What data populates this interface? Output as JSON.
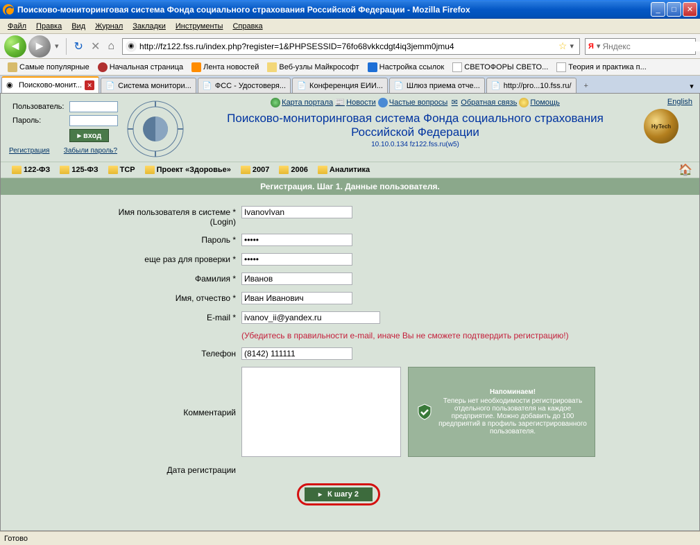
{
  "window": {
    "title": "Поисково-мониторинговая система Фонда социального страхования Российской Федерации - Mozilla Firefox"
  },
  "menu": {
    "file": "Файл",
    "edit": "Правка",
    "view": "Вид",
    "history": "Журнал",
    "bookmarks": "Закладки",
    "tools": "Инструменты",
    "help": "Справка"
  },
  "urlbar": {
    "url": "http://fz122.fss.ru/index.php?register=1&PHPSESSID=76fo68vkkcdgt4iq3jemm0jmu4"
  },
  "search": {
    "placeholder": "Яндекс",
    "icon": "Я"
  },
  "bookmarks": [
    {
      "label": "Самые популярные",
      "icon": "pop"
    },
    {
      "label": "Начальная страница",
      "icon": "red"
    },
    {
      "label": "Лента новостей",
      "icon": "rss"
    },
    {
      "label": "Веб-узлы Майкрософт",
      "icon": "folder"
    },
    {
      "label": "Настройка ссылок",
      "icon": "blue"
    },
    {
      "label": "СВЕТОФОРЫ СВЕТО...",
      "icon": "white"
    },
    {
      "label": "Теория и практика п...",
      "icon": "white"
    }
  ],
  "tabs": [
    {
      "label": "Поисково-монит...",
      "active": true
    },
    {
      "label": "Система монитори..."
    },
    {
      "label": "ФСС - Удостоверя..."
    },
    {
      "label": "Конференция ЕИИ..."
    },
    {
      "label": "Шлюз приема отче..."
    },
    {
      "label": "http://pro...10.fss.ru/"
    }
  ],
  "login": {
    "user_label": "Пользователь:",
    "pass_label": "Пароль:",
    "button": "вход",
    "register": "Регистрация",
    "forgot": "Забыли пароль?"
  },
  "topnav": {
    "map": "Карта портала",
    "news": "Новости",
    "faq": "Частые вопросы",
    "feedback": "Обратная связь",
    "help": "Помощь",
    "english": "English"
  },
  "header": {
    "title1": "Поисково-мониторинговая система Фонда социального страхования",
    "title2": "Российской Федерации",
    "sub": "10.10.0.134  fz122.fss.ru(w5)"
  },
  "folders": [
    "122-ФЗ",
    "125-ФЗ",
    "TCP",
    "Проект «Здоровье»",
    "2007",
    "2006",
    "Аналитика"
  ],
  "step": {
    "title": "Регистрация. Шаг 1. Данные пользователя."
  },
  "form": {
    "login_label": "Имя пользователя в системе *\n(Login)",
    "login_label1": "Имя пользователя в системе *",
    "login_label2": "(Login)",
    "login_val": "IvanovIvan",
    "pass_label": "Пароль *",
    "pass_val": "●●●●●",
    "pass2_label": "еще раз для проверки *",
    "pass2_val": "●●●●●",
    "lastname_label": "Фамилия *",
    "lastname_val": "Иванов",
    "firstname_label": "Имя, отчество *",
    "firstname_val": "Иван Иванович",
    "email_label": "E-mail *",
    "email_val": "ivanov_ii@yandex.ru",
    "email_warn": "(Убедитесь в правильности e-mail, иначе Вы не сможете подтвердить регистрацию!)",
    "phone_label": "Телефон",
    "phone_val": "(8142) 111111",
    "comment_label": "Комментарий",
    "remind_title": "Напоминаем!",
    "remind_text": "Теперь нет необходимости регистрировать отдельного пользователя на каждое предприятие. Можно добавить до 100 предприятий в профиль зарегистрированного пользователя.",
    "date_label": "Дата регистрации",
    "submit": "К шагу 2"
  },
  "status": {
    "text": "Готово"
  }
}
